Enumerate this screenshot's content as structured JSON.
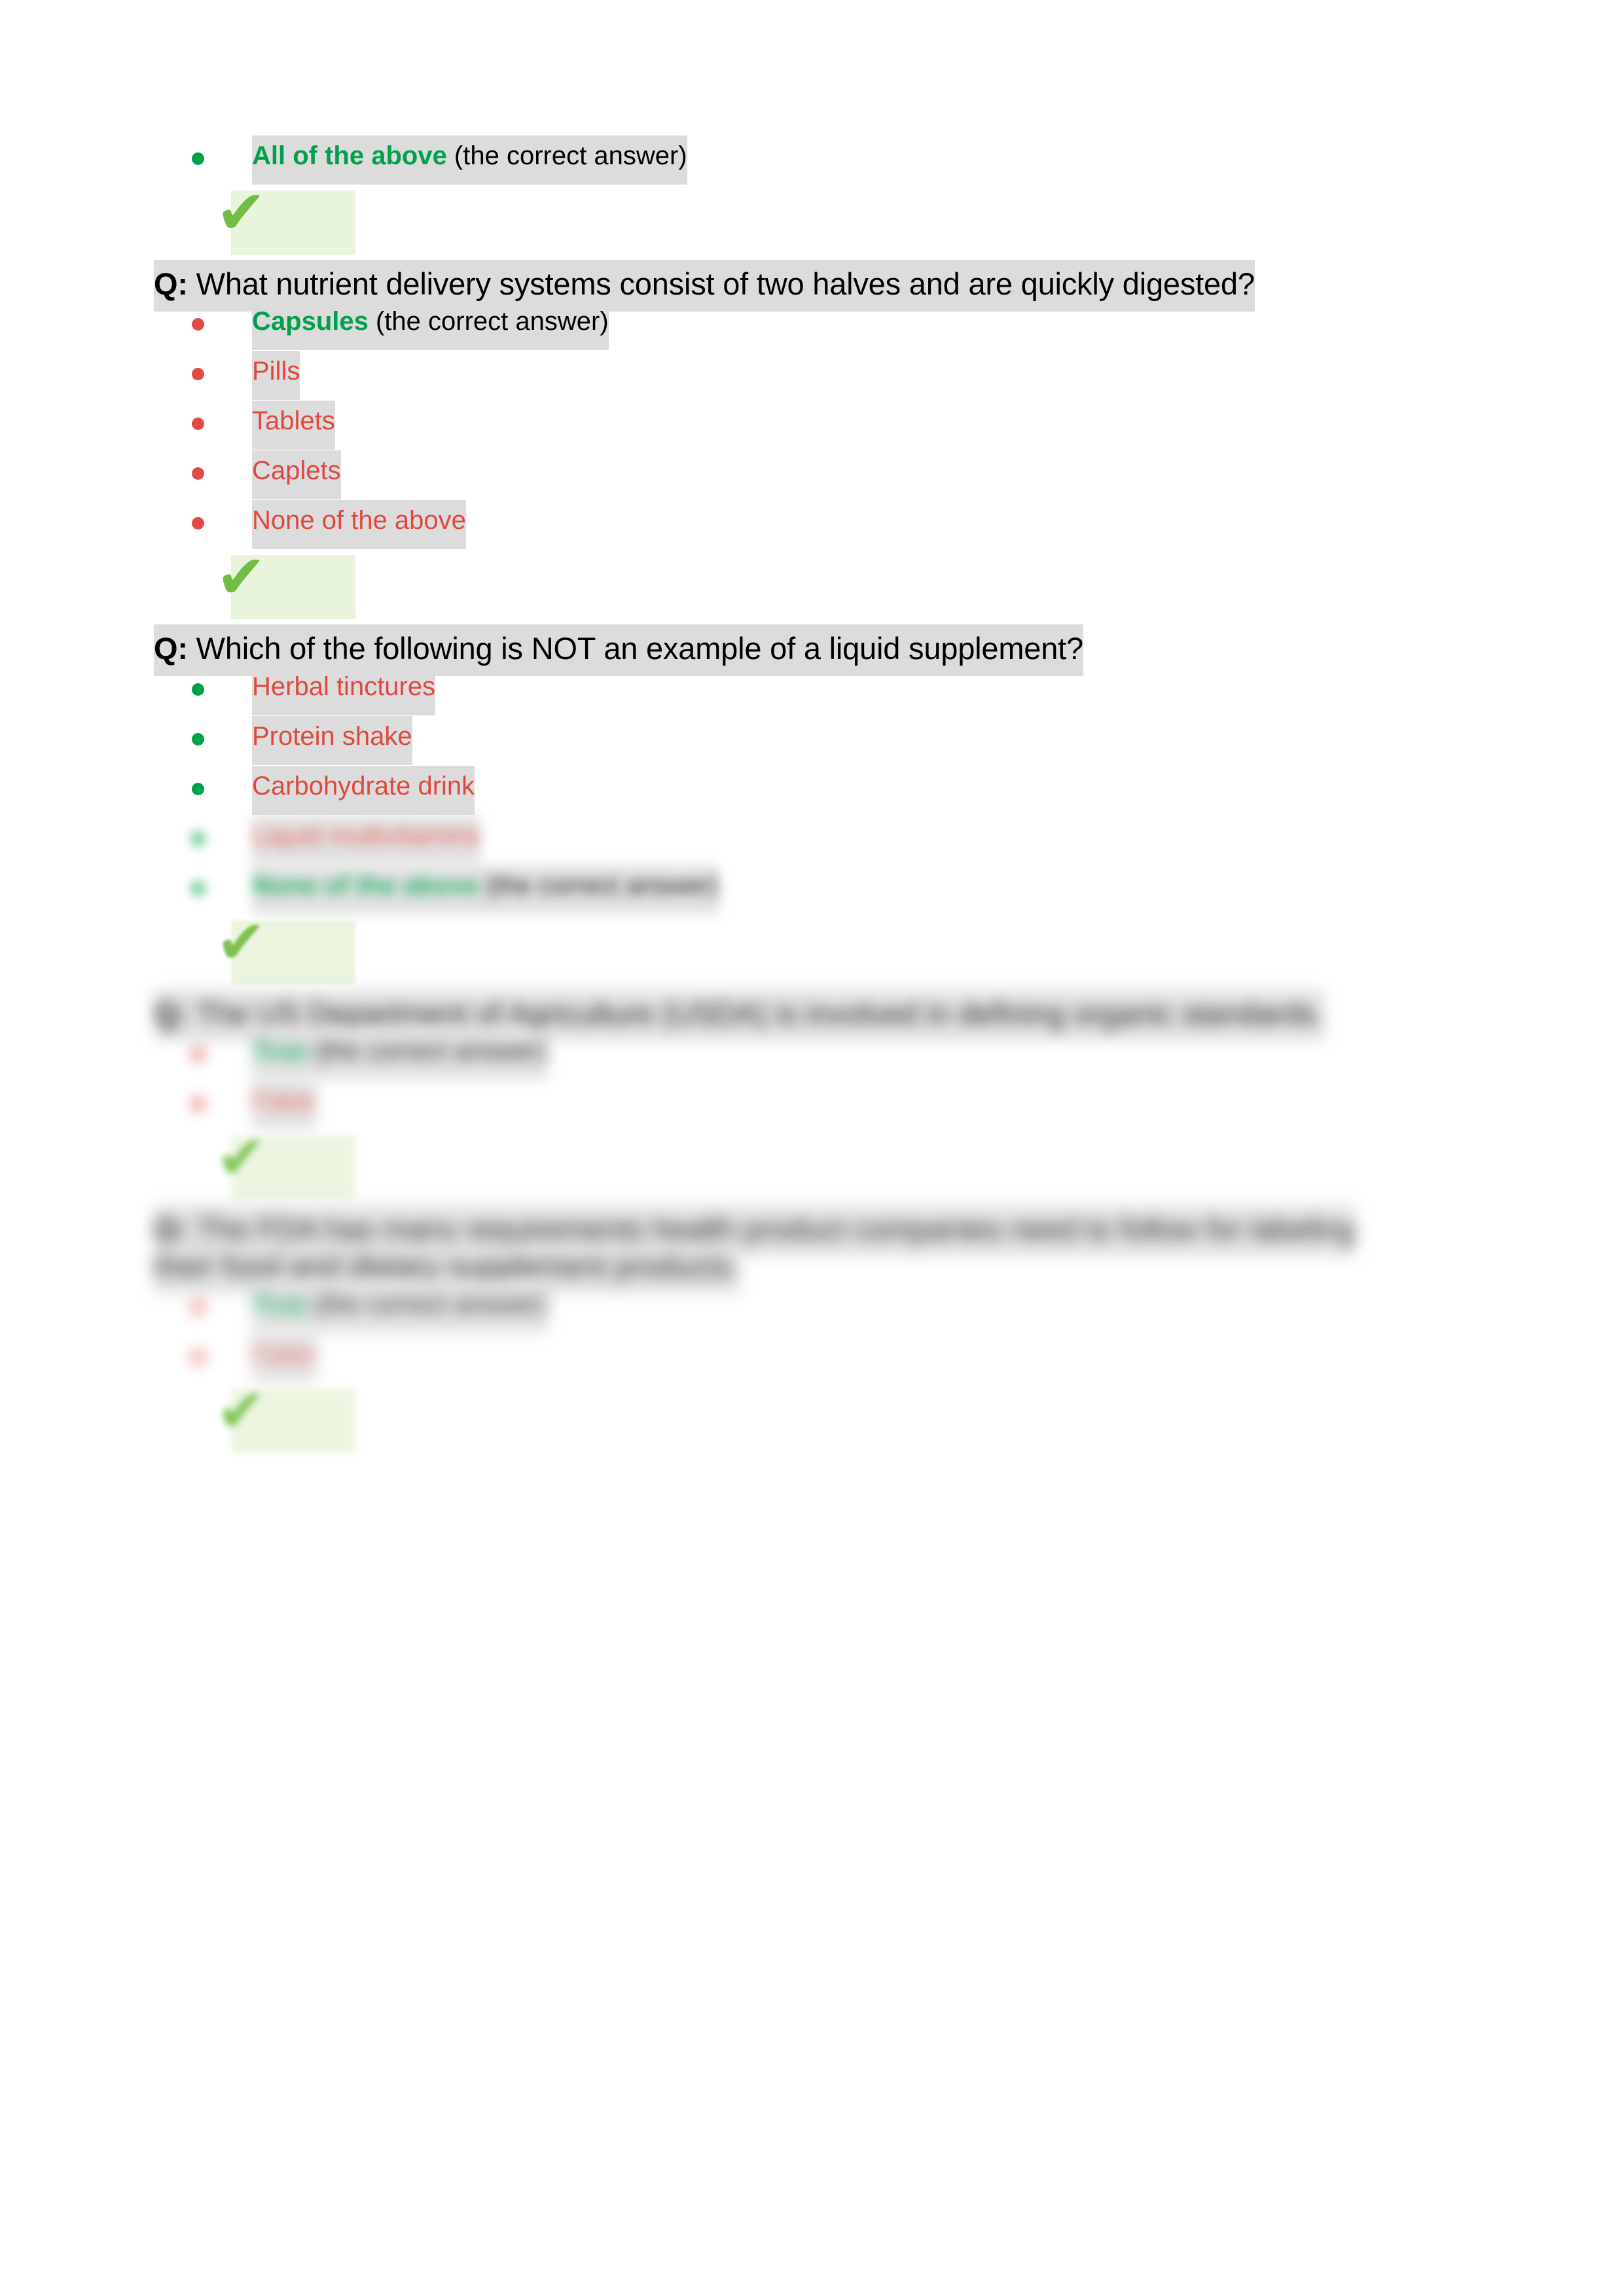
{
  "document": {
    "type": "quiz-answer-key",
    "page_background": "#ffffff",
    "colors": {
      "correct_green": "#00A14B",
      "wrong_red": "#E0483F",
      "text_highlight_gray": "#dcdcdc",
      "check_highlight_green": "#e9f4dc",
      "checkmark_green": "#72BD44",
      "body_text_black": "#000000"
    },
    "correct_suffix": "(the correct answer)",
    "checkmark_glyph": "✔"
  },
  "blocks": [
    {
      "kind": "orphan-option",
      "name": "orphan-correct-option",
      "bullet_color": "green",
      "correct": true,
      "label": "All of the above",
      "note": "(the correct answer)",
      "blur": "none"
    },
    {
      "kind": "checkmark",
      "name": "checkmark-1",
      "blur": "none"
    },
    {
      "kind": "question",
      "name": "question-2",
      "prefix": "Q:",
      "text": "What nutrient delivery systems consist of two halves and are quickly digested?",
      "blur": "none",
      "bullet_color": "red",
      "options": [
        {
          "label": "Capsules",
          "note": "(the correct answer)",
          "correct": true,
          "blur": "none"
        },
        {
          "label": "Pills",
          "note": "",
          "correct": false,
          "blur": "none"
        },
        {
          "label": "Tablets",
          "note": "",
          "correct": false,
          "blur": "none"
        },
        {
          "label": "Caplets",
          "note": "",
          "correct": false,
          "blur": "none"
        },
        {
          "label": "None of the above",
          "note": "",
          "correct": false,
          "blur": "none"
        }
      ]
    },
    {
      "kind": "checkmark",
      "name": "checkmark-2",
      "blur": "none"
    },
    {
      "kind": "question",
      "name": "question-3",
      "prefix": "Q:",
      "text": "Which of the following is NOT an example of a liquid supplement?",
      "blur": "none",
      "bullet_color": "green",
      "options": [
        {
          "label": "Herbal tinctures",
          "note": "",
          "correct": false,
          "blur": "none"
        },
        {
          "label": "Protein shake",
          "note": "",
          "correct": false,
          "blur": "none"
        },
        {
          "label": "Carbohydrate drink",
          "note": "",
          "correct": false,
          "blur": "none"
        },
        {
          "label": "Liquid multivitamins",
          "note": "",
          "correct": false,
          "blur": "b3"
        },
        {
          "label": "None of the above",
          "note": "(the correct answer)",
          "correct": true,
          "blur": "b3"
        }
      ]
    },
    {
      "kind": "checkmark",
      "name": "checkmark-3",
      "blur": "b1"
    },
    {
      "kind": "question",
      "name": "question-4",
      "prefix": "Q:",
      "text": "The US Department of Agriculture (USDA) is involved in defining organic standards.",
      "blur": "b4",
      "bullet_color": "red",
      "options": [
        {
          "label": "True",
          "note": "(the correct answer)",
          "correct": true,
          "blur": "b4"
        },
        {
          "label": "False",
          "note": "",
          "correct": false,
          "blur": "b4"
        }
      ]
    },
    {
      "kind": "checkmark",
      "name": "checkmark-4",
      "blur": "b2"
    },
    {
      "kind": "question",
      "name": "question-5",
      "prefix": "Q:",
      "text": "The FDA has many requirements health product companies need to follow for labeling their food and dietary supplement products.",
      "blur": "b5",
      "bullet_color": "red",
      "options": [
        {
          "label": "True",
          "note": "(the correct answer)",
          "correct": true,
          "blur": "b5"
        },
        {
          "label": "False",
          "note": "",
          "correct": false,
          "blur": "b5"
        }
      ]
    },
    {
      "kind": "checkmark",
      "name": "checkmark-5",
      "blur": "b2"
    }
  ]
}
